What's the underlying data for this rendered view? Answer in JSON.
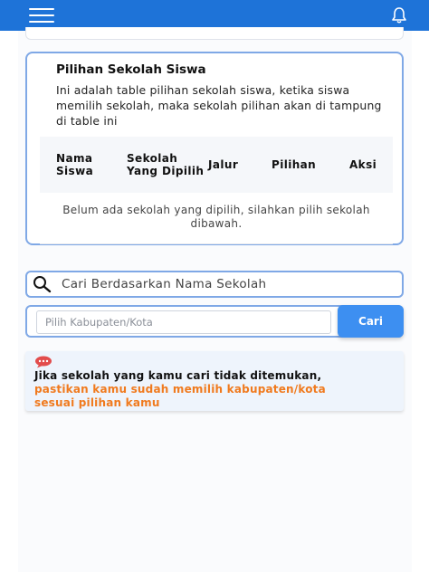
{
  "colors": {
    "topbar": "#1e73d8",
    "accent_border": "#7fa8e6",
    "button": "#3d8ff1",
    "warning_text": "#f07a1e",
    "notice_bg": "#eef4fc",
    "chat_icon": "#e24c4c"
  },
  "topbar": {
    "menu_icon": "hamburger-icon",
    "bell_icon": "bell-icon"
  },
  "card": {
    "title": "Pilihan Sekolah Siswa",
    "description": "Ini adalah table pilihan sekolah siswa, ketika siswa memilih sekolah, maka sekolah pilihan akan di tampung di table ini",
    "table": {
      "headers": [
        "Nama Siswa",
        "Sekolah Yang Dipilih",
        "Jalur",
        "Pilihan",
        "Aksi"
      ],
      "empty_message": "Belum ada sekolah yang dipilih, silahkan pilih sekolah dibawah."
    }
  },
  "search": {
    "icon": "search-icon",
    "placeholder": "Cari Berdasarkan Nama Sekolah"
  },
  "filter": {
    "placeholder": "Pilih Kabupaten/Kota",
    "button_label": "Cari"
  },
  "notice": {
    "icon": "chat-bubble-icon",
    "line1": "Jika sekolah yang kamu cari tidak ditemukan,",
    "line2": "pastikan kamu sudah memilih kabupaten/kota",
    "line3": "sesuai pilihan kamu"
  }
}
